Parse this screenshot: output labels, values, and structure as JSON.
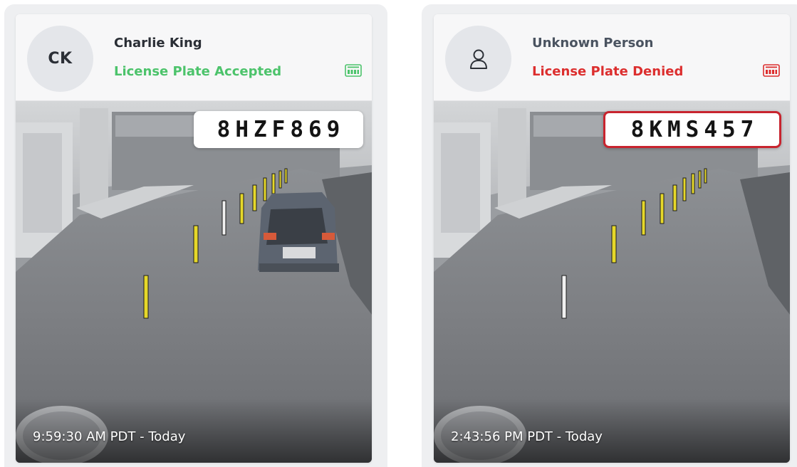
{
  "events": [
    {
      "avatar_text": "CK",
      "avatar_icon": "person-icon",
      "name": "Charlie King",
      "status": "License Plate Accepted",
      "status_color": "#4cc36b",
      "plate_icon": "license-plate-icon",
      "plate_number": "8HZF869",
      "timestamp": "9:59:30 AM PDT - Today"
    },
    {
      "avatar_text": "",
      "avatar_icon": "person-icon",
      "name": "Unknown Person",
      "status": "License Plate Denied",
      "status_color": "#dc2e2e",
      "plate_icon": "license-plate-icon",
      "plate_number": "8KMS457",
      "timestamp": "2:43:56 PM PDT - Today"
    }
  ]
}
